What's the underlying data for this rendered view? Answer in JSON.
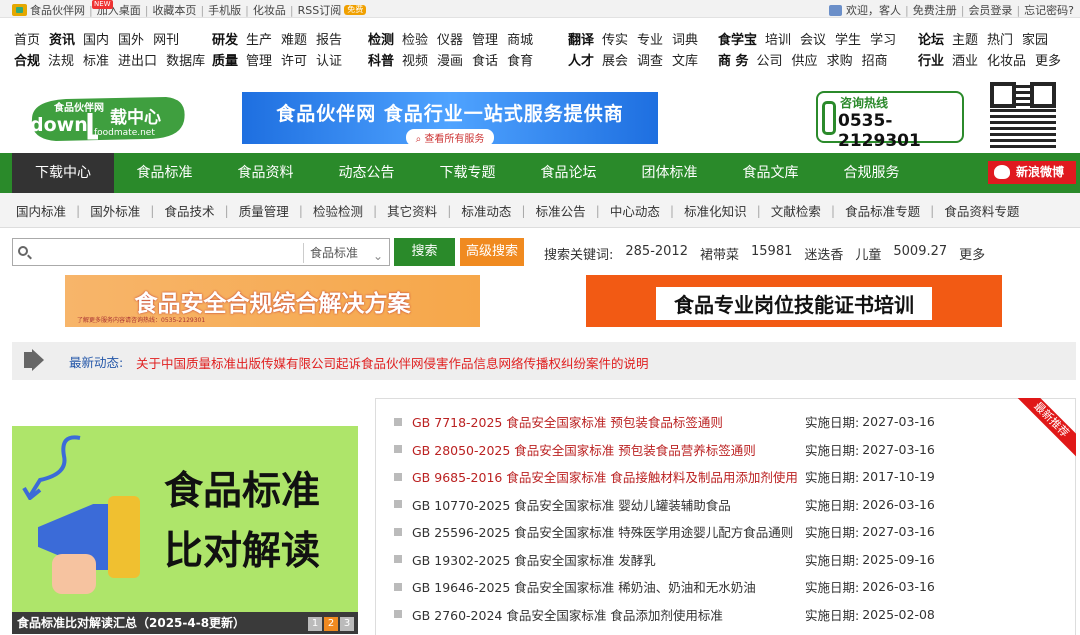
{
  "topbar": {
    "site_name": "食品伙伴网",
    "new_tag": "NEW",
    "links": [
      "加入桌面",
      "收藏本页",
      "手机版",
      "化妆品",
      "RSS订阅"
    ],
    "free_tag": "免费",
    "greeting": "欢迎，客人",
    "right_links": [
      "免费注册",
      "会员登录",
      "忘记密码?"
    ]
  },
  "nav_groups": [
    {
      "rows": [
        {
          "items": [
            "首页",
            "资讯",
            "国内",
            "国外",
            "网刊"
          ]
        },
        {
          "items": [
            "合规",
            "法规",
            "标准",
            "进出口",
            "数据库"
          ]
        }
      ]
    },
    {
      "rows": [
        {
          "head": "研发",
          "items": [
            "生产",
            "难题",
            "报告"
          ]
        },
        {
          "head": "质量",
          "items": [
            "管理",
            "许可",
            "认证"
          ]
        }
      ]
    },
    {
      "rows": [
        {
          "head": "检测",
          "items": [
            "检验",
            "仪器",
            "管理",
            "商城"
          ]
        },
        {
          "head": "科普",
          "items": [
            "视频",
            "漫画",
            "食话",
            "食育"
          ]
        }
      ]
    },
    {
      "rows": [
        {
          "head": "翻译",
          "items": [
            "传实",
            "专业",
            "词典"
          ]
        },
        {
          "head": "人才",
          "items": [
            "展会",
            "调查",
            "文库"
          ]
        }
      ]
    },
    {
      "rows": [
        {
          "head": "食学宝",
          "items": [
            "培训",
            "会议",
            "学生",
            "学习"
          ]
        },
        {
          "head": "商 务",
          "items": [
            "公司",
            "供应",
            "求购",
            "招商"
          ]
        }
      ]
    },
    {
      "rows": [
        {
          "head": "论坛",
          "items": [
            "主题",
            "热门",
            "家园"
          ]
        },
        {
          "head": "行业",
          "items": [
            "酒业",
            "化妆品",
            "更多"
          ]
        }
      ]
    }
  ],
  "header": {
    "logo_text": "食品伙伴网",
    "logo_sub": "down",
    "logo_center": "载中心",
    "logo_domain": "foodmate.net",
    "banner_title": "食品伙伴网 食品行业一站式服务提供商",
    "banner_button": "查看所有服务",
    "hotline_label": "咨询热线",
    "hotline_number": "0535-2129301"
  },
  "main_nav": [
    "下载中心",
    "食品标准",
    "食品资料",
    "动态公告",
    "下载专题",
    "食品论坛",
    "团体标准",
    "食品文库",
    "合规服务"
  ],
  "weibo_label": "新浪微博",
  "sub_nav": [
    "国内标准",
    "国外标准",
    "食品技术",
    "质量管理",
    "检验检测",
    "其它资料",
    "标准动态",
    "标准公告",
    "中心动态",
    "标准化知识",
    "文献检索",
    "食品标准专题",
    "食品资料专题"
  ],
  "search": {
    "placeholder": "",
    "category": "食品标准",
    "search_label": "搜索",
    "advanced_label": "高级搜索",
    "keywords_label": "搜索关键词:",
    "keywords": [
      "285-2012",
      "裙带菜",
      "15981",
      "迷迭香",
      "儿童",
      "5009.27",
      "更多"
    ]
  },
  "ads": {
    "ad1": "食品安全合规综合解决方案",
    "ad1_small": "了解更多服务内容请咨询热线：0535-2129301",
    "ad2": "食品专业岗位技能证书培训"
  },
  "notice": {
    "label": "最新动态:",
    "text": "关于中国质量标准出版传媒有限公司起诉食品伙伴网侵害作品信息网络传播权纠纷案件的说明"
  },
  "promo": {
    "line1": "食品标准",
    "line2": "比对解读",
    "caption": "食品标准比对解读汇总（2025-4-8更新）",
    "pages": [
      "1",
      "2",
      "3"
    ]
  },
  "recommend": {
    "ribbon": "最新推荐",
    "date_label": "实施日期:",
    "items": [
      {
        "title": "GB 7718-2025 食品安全国家标准 预包装食品标签通则",
        "date": "2027-03-16"
      },
      {
        "title": "GB 28050-2025 食品安全国家标准 预包装食品营养标签通则",
        "date": "2027-03-16"
      },
      {
        "title": "GB 9685-2016 食品安全国家标准 食品接触材料及制品用添加剂使用",
        "date": "2017-10-19"
      },
      {
        "title": "GB 10770-2025 食品安全国家标准 婴幼儿罐装辅助食品",
        "date": "2026-03-16"
      },
      {
        "title": "GB 25596-2025 食品安全国家标准 特殊医学用途婴儿配方食品通则",
        "date": "2027-03-16"
      },
      {
        "title": "GB 19302-2025 食品安全国家标准 发酵乳",
        "date": "2025-09-16"
      },
      {
        "title": "GB 19646-2025 食品安全国家标准 稀奶油、奶油和无水奶油",
        "date": "2026-03-16"
      },
      {
        "title": "GB 2760-2024 食品安全国家标准 食品添加剂使用标准",
        "date": "2025-02-08"
      }
    ]
  },
  "colors": {
    "brand_green": "#2a8a2a",
    "accent_orange": "#f08a20",
    "notice_red": "#e02020",
    "link_red": "#b22222"
  }
}
